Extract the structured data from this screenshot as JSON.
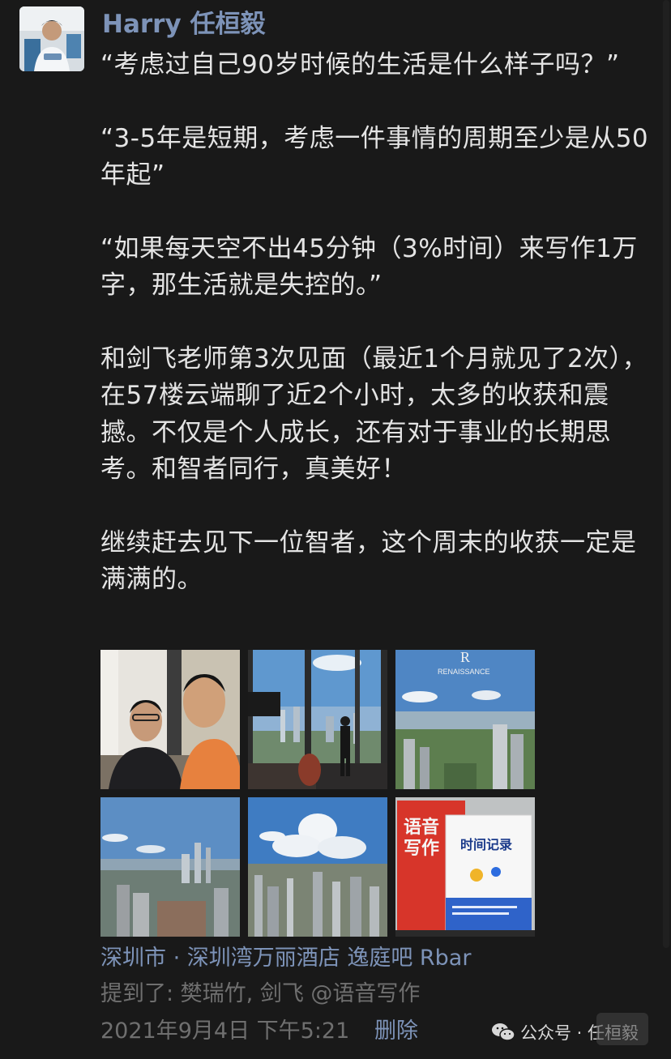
{
  "author": {
    "name": "Harry 任桓毅"
  },
  "post": {
    "paragraphs": [
      "“考虑过自己90岁时候的生活是什么样子吗？”",
      "“3-5年是短期，考虑一件事情的周期至少是从50年起”",
      "“如果每天空不出45分钟（3%时间）来写作1万字，那生活就是失控的。”",
      "和剑飞老师第3次见面（最近1个月就见了2次），在57楼云端聊了近2个小时，太多的收获和震撼。不仅是个人成长，还有对于事业的长期思考。和智者同行，真美好！",
      "继续赶去见下一位智者，这个周末的收获一定是满满的。"
    ]
  },
  "photos": {
    "book1_title": "语音写作",
    "book2_title": "时间记录",
    "hotel_sign": "RENAISSANCE"
  },
  "location": "深圳市 · 深圳湾万丽酒店 逸庭吧 Rbar",
  "mentions": "提到了: 樊瑞竹, 剑飞 @语音写作",
  "timestamp": "2021年9月4日 下午5:21",
  "delete_label": "删除",
  "watermark": "公众号 · 任桓毅",
  "colors": {
    "background": "#191919",
    "link": "#7d93b8",
    "text": "#e4e4e4",
    "meta": "#6f6f6f"
  }
}
